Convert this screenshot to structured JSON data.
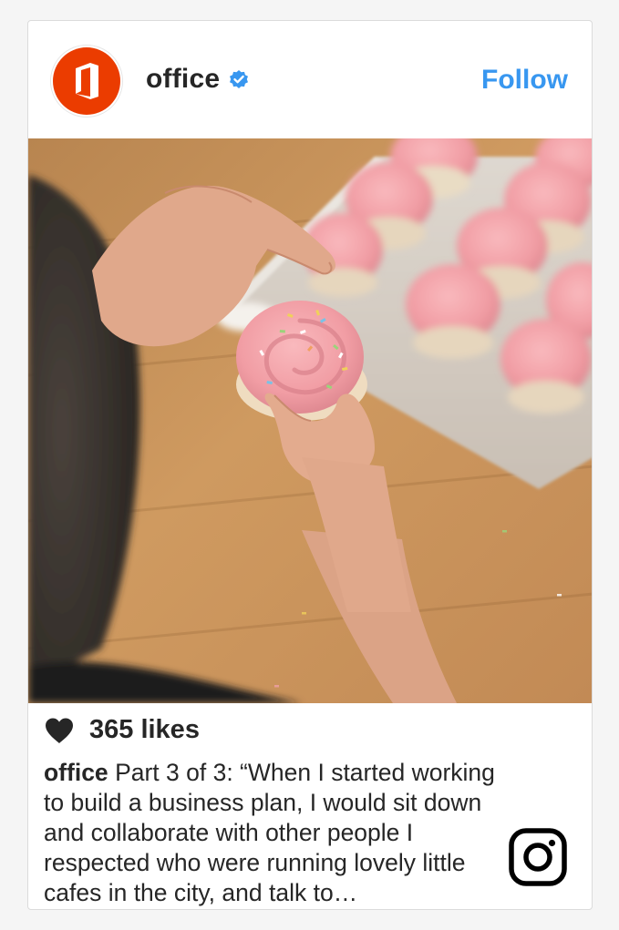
{
  "post": {
    "username": "office",
    "verified_icon": "verified-badge-icon",
    "follow_label": "Follow",
    "likes": "365 likes",
    "caption_user": "office",
    "caption_text": "Part 3 of 3: “When I started working to build a business plan, I would sit down and collaborate with other people I respected who were running lovely little cafes in the city, and talk to…"
  },
  "icons": {
    "avatar": "office-logo-icon",
    "like": "heart-icon",
    "brand": "instagram-icon"
  },
  "colors": {
    "accent": "#3897f0",
    "office_red": "#eb3c00",
    "text": "#262626",
    "frosting": "#f3a3aa"
  }
}
